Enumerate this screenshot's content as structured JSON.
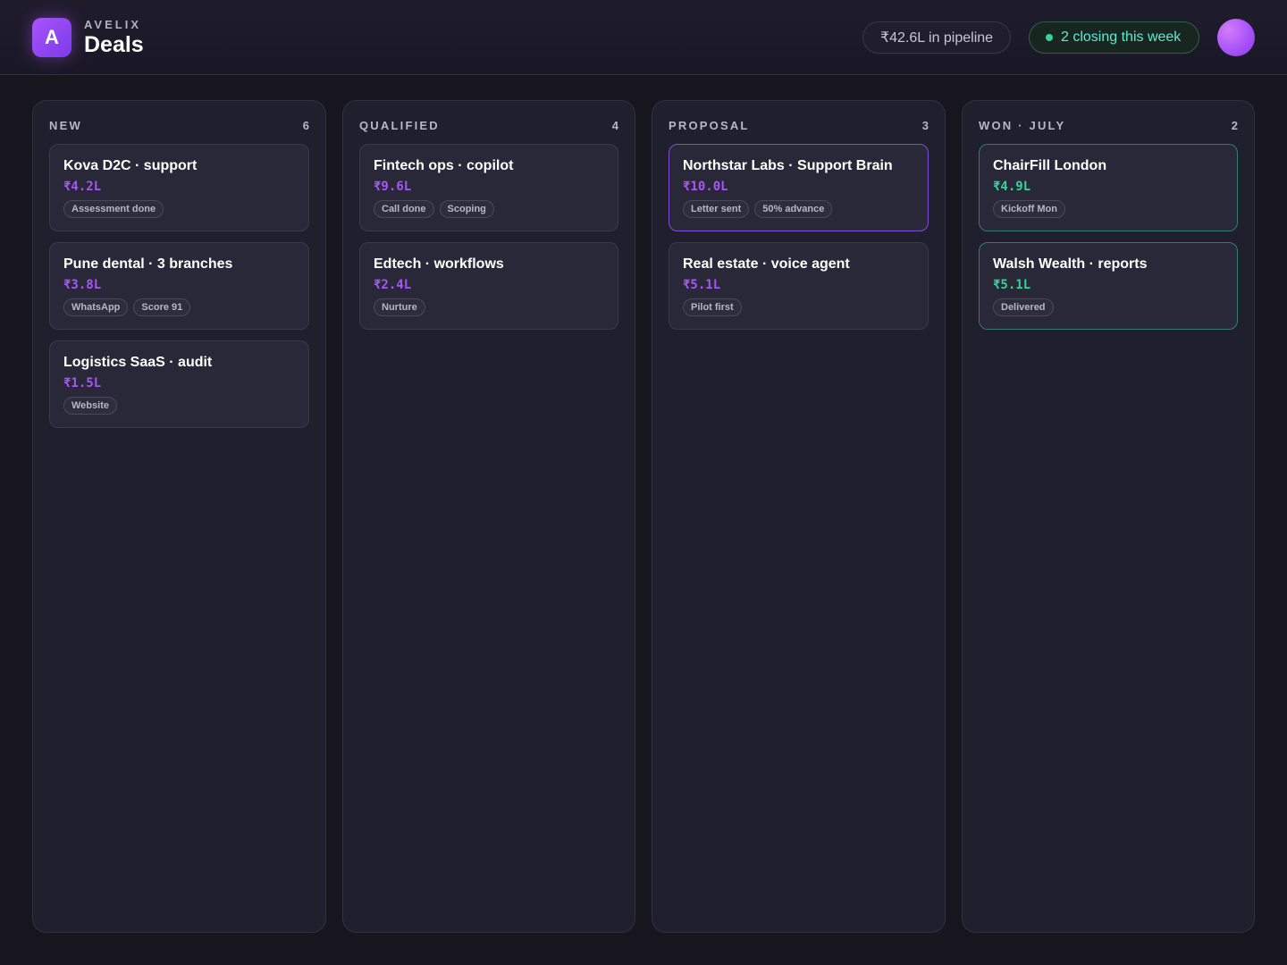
{
  "header": {
    "brand": "AVELIX",
    "logo_letter": "A",
    "title": "Deals",
    "pipeline_pill": "₹42.6L in pipeline",
    "closing_pill": "2 closing this week"
  },
  "colors": {
    "accent": "#a855f7",
    "success": "#34d399",
    "background": "#17161f"
  },
  "columns": [
    {
      "title": "NEW",
      "count": "6",
      "cards": [
        {
          "title": "Kova D2C · support",
          "amount": "₹4.2L",
          "tags": [
            "Assessment done"
          ]
        },
        {
          "title": "Pune dental · 3 branches",
          "amount": "₹3.8L",
          "tags": [
            "WhatsApp",
            "Score 91"
          ]
        },
        {
          "title": "Logistics SaaS · audit",
          "amount": "₹1.5L",
          "tags": [
            "Website"
          ]
        }
      ]
    },
    {
      "title": "QUALIFIED",
      "count": "4",
      "cards": [
        {
          "title": "Fintech ops · copilot",
          "amount": "₹9.6L",
          "tags": [
            "Call done",
            "Scoping"
          ]
        },
        {
          "title": "Edtech · workflows",
          "amount": "₹2.4L",
          "tags": [
            "Nurture"
          ]
        }
      ]
    },
    {
      "title": "PROPOSAL",
      "count": "3",
      "cards": [
        {
          "title": "Northstar Labs · Support Brain",
          "amount": "₹10.0L",
          "tags": [
            "Letter sent",
            "50% advance"
          ],
          "highlight": "purple"
        },
        {
          "title": "Real estate · voice agent",
          "amount": "₹5.1L",
          "tags": [
            "Pilot first"
          ]
        }
      ]
    },
    {
      "title": "WON · JULY",
      "count": "2",
      "cards": [
        {
          "title": "ChairFill London",
          "amount": "₹4.9L",
          "tags": [
            "Kickoff Mon"
          ],
          "highlight": "green"
        },
        {
          "title": "Walsh Wealth · reports",
          "amount": "₹5.1L",
          "tags": [
            "Delivered"
          ],
          "highlight": "green"
        }
      ]
    }
  ]
}
